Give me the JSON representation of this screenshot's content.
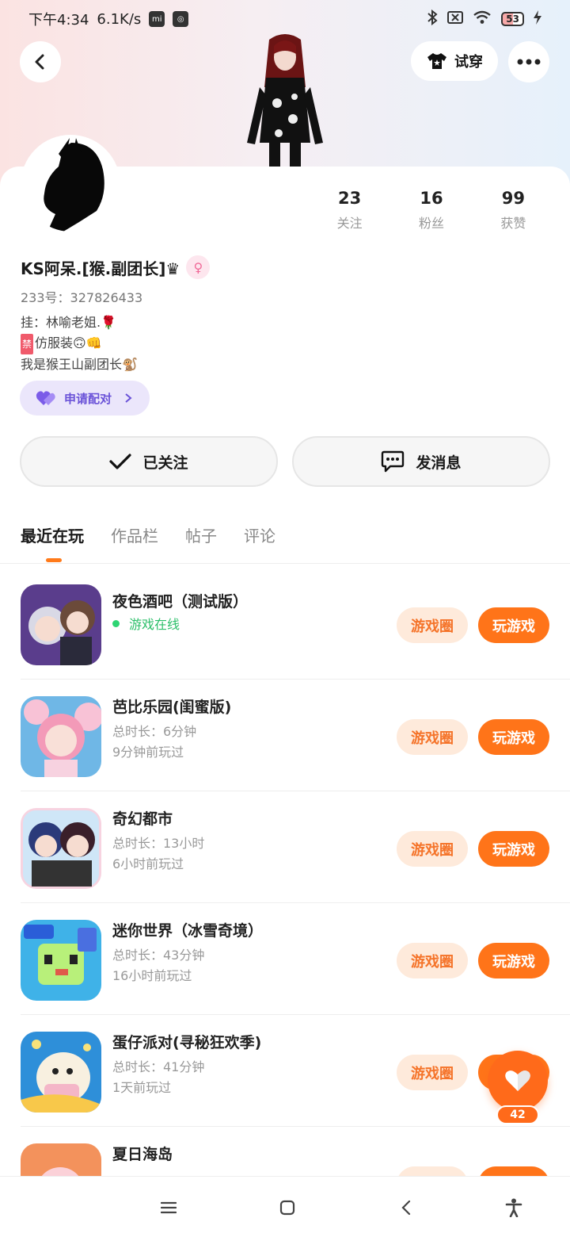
{
  "status_bar": {
    "time": "下午4:34",
    "speed": "6.1K/s",
    "battery": "53"
  },
  "header": {
    "try_on_label": "试穿"
  },
  "profile": {
    "stats": [
      {
        "num": "23",
        "label": "关注"
      },
      {
        "num": "16",
        "label": "粉丝"
      },
      {
        "num": "99",
        "label": "获赞"
      }
    ],
    "username": "KS阿呆.[猴.副团长]♛",
    "uid": "233号：327826433",
    "bio_line1": "挂：林喻老姐.🌹",
    "bio_line2_tag": "禁",
    "bio_line2": "仿服装🙃👊",
    "bio_line3": "我是猴王山副团长🐒",
    "pair_label": "申请配对"
  },
  "actions": {
    "followed_label": "已关注",
    "message_label": "发消息"
  },
  "tabs": [
    {
      "label": "最近在玩"
    },
    {
      "label": "作品栏"
    },
    {
      "label": "帖子"
    },
    {
      "label": "评论"
    }
  ],
  "games": [
    {
      "name": "夜色酒吧（测试版）",
      "meta1": "游戏在线",
      "meta2": "",
      "online": true,
      "colors": [
        "#5a3d8c",
        "#c9c3e0"
      ]
    },
    {
      "name": "芭比乐园(闺蜜版)",
      "meta1": "总时长：6分钟",
      "meta2": "9分钟前玩过",
      "online": false,
      "colors": [
        "#f7b5c9",
        "#6fb7e6"
      ]
    },
    {
      "name": "奇幻都市",
      "meta1": "总时长：13小时",
      "meta2": "6小时前玩过",
      "online": false,
      "colors": [
        "#2b3a7a",
        "#f7d3e0"
      ]
    },
    {
      "name": "迷你世界（冰雪奇境）",
      "meta1": "总时长：43分钟",
      "meta2": "16小时前玩过",
      "online": false,
      "colors": [
        "#3fb2e8",
        "#b8f07a"
      ]
    },
    {
      "name": "蛋仔派对(寻秘狂欢季)",
      "meta1": "总时长：41分钟",
      "meta2": "1天前玩过",
      "online": false,
      "colors": [
        "#2e8fd9",
        "#f8e27a"
      ]
    },
    {
      "name": "夏日海岛",
      "meta1": "",
      "meta2": "",
      "online": false,
      "colors": [
        "#f3925c",
        "#fbd1d8"
      ]
    }
  ],
  "game_buttons": {
    "circle_label": "游戏圈",
    "play_label": "玩游戏"
  },
  "fab": {
    "count": "42"
  },
  "colors": {
    "accent": "#ff7419",
    "accent_light": "#feeadb",
    "pair_purple": "#6a52d8",
    "online_green": "#2cbf6a"
  }
}
